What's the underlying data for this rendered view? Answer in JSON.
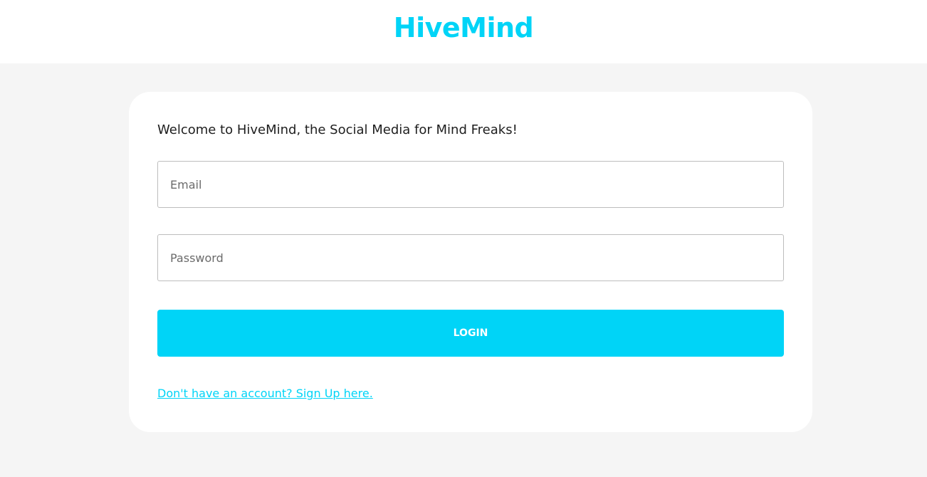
{
  "colors": {
    "brand": "#00d4f7",
    "background": "#f5f5f5",
    "card": "#ffffff"
  },
  "header": {
    "logo_text": "HiveMind"
  },
  "login": {
    "welcome": "Welcome to HiveMind, the Social Media for Mind Freaks!",
    "email_placeholder": "Email",
    "email_value": "",
    "password_placeholder": "Password",
    "password_value": "",
    "login_label": "LOGIN",
    "signup_link": "Don't have an account? Sign Up here."
  }
}
